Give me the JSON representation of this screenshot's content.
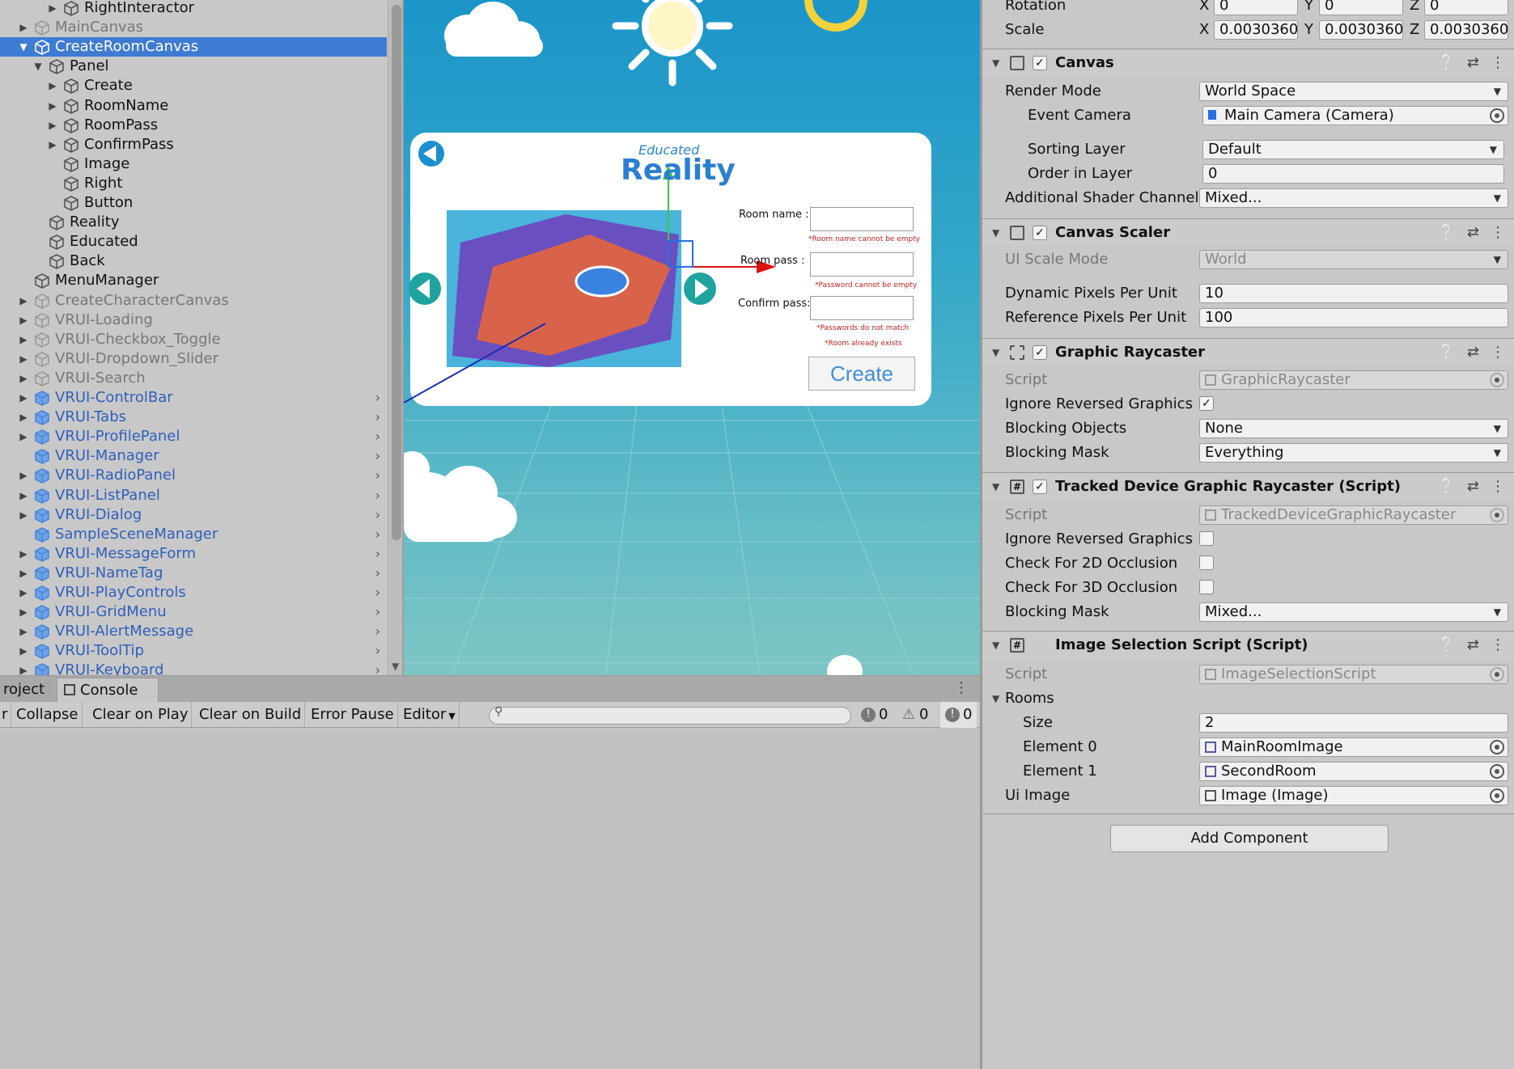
{
  "hierarchy": {
    "items": [
      {
        "label": "RightInteractor",
        "indent": 3,
        "arrow": true,
        "style": "normal"
      },
      {
        "label": "MainCanvas",
        "indent": 1,
        "arrow": true,
        "style": "grey"
      },
      {
        "label": "CreateRoomCanvas",
        "indent": 1,
        "arrow": true,
        "style": "selected",
        "open": true
      },
      {
        "label": "Panel",
        "indent": 2,
        "arrow": true,
        "style": "normal",
        "open": true
      },
      {
        "label": "Create",
        "indent": 3,
        "arrow": true,
        "style": "normal"
      },
      {
        "label": "RoomName",
        "indent": 3,
        "arrow": true,
        "style": "normal"
      },
      {
        "label": "RoomPass",
        "indent": 3,
        "arrow": true,
        "style": "normal"
      },
      {
        "label": "ConfirmPass",
        "indent": 3,
        "arrow": true,
        "style": "normal"
      },
      {
        "label": "Image",
        "indent": 3,
        "arrow": false,
        "style": "normal"
      },
      {
        "label": "Right",
        "indent": 3,
        "arrow": false,
        "style": "normal"
      },
      {
        "label": "Button",
        "indent": 3,
        "arrow": false,
        "style": "normal"
      },
      {
        "label": "Reality",
        "indent": 2,
        "arrow": false,
        "style": "normal"
      },
      {
        "label": "Educated",
        "indent": 2,
        "arrow": false,
        "style": "normal"
      },
      {
        "label": "Back",
        "indent": 2,
        "arrow": false,
        "style": "normal"
      },
      {
        "label": "MenuManager",
        "indent": 1,
        "arrow": false,
        "style": "normal"
      },
      {
        "label": "CreateCharacterCanvas",
        "indent": 1,
        "arrow": true,
        "style": "grey"
      },
      {
        "label": "VRUI-Loading",
        "indent": 1,
        "arrow": true,
        "style": "grey"
      },
      {
        "label": "VRUI-Checkbox_Toggle",
        "indent": 1,
        "arrow": true,
        "style": "grey"
      },
      {
        "label": "VRUI-Dropdown_Slider",
        "indent": 1,
        "arrow": true,
        "style": "grey"
      },
      {
        "label": "VRUI-Search",
        "indent": 1,
        "arrow": true,
        "style": "grey"
      },
      {
        "label": "VRUI-ControlBar",
        "indent": 1,
        "arrow": true,
        "style": "prefab"
      },
      {
        "label": "VRUI-Tabs",
        "indent": 1,
        "arrow": true,
        "style": "prefab"
      },
      {
        "label": "VRUI-ProfilePanel",
        "indent": 1,
        "arrow": true,
        "style": "prefab"
      },
      {
        "label": "VRUI-Manager",
        "indent": 1,
        "arrow": false,
        "style": "prefab"
      },
      {
        "label": "VRUI-RadioPanel",
        "indent": 1,
        "arrow": true,
        "style": "prefab"
      },
      {
        "label": "VRUI-ListPanel",
        "indent": 1,
        "arrow": true,
        "style": "prefab"
      },
      {
        "label": "VRUI-Dialog",
        "indent": 1,
        "arrow": true,
        "style": "prefab"
      },
      {
        "label": "SampleSceneManager",
        "indent": 1,
        "arrow": false,
        "style": "prefab"
      },
      {
        "label": "VRUI-MessageForm",
        "indent": 1,
        "arrow": true,
        "style": "prefab"
      },
      {
        "label": "VRUI-NameTag",
        "indent": 1,
        "arrow": true,
        "style": "prefab"
      },
      {
        "label": "VRUI-PlayControls",
        "indent": 1,
        "arrow": true,
        "style": "prefab"
      },
      {
        "label": "VRUI-GridMenu",
        "indent": 1,
        "arrow": true,
        "style": "prefab"
      },
      {
        "label": "VRUI-AlertMessage",
        "indent": 1,
        "arrow": true,
        "style": "prefab"
      },
      {
        "label": "VRUI-ToolTip",
        "indent": 1,
        "arrow": true,
        "style": "prefab"
      },
      {
        "label": "VRUI-Keyboard",
        "indent": 1,
        "arrow": true,
        "style": "prefab"
      }
    ]
  },
  "scene": {
    "educated": "Educated",
    "reality": "Reality",
    "room_name_label": "Room name :",
    "room_pass_label": "Room pass :",
    "confirm_pass_label": "Confirm pass:",
    "err_room_name": "*Room name cannot be empty",
    "err_password": "*Password cannot be empty",
    "err_match": "*Passwords do not match",
    "err_exists": "*Room already exists",
    "create_button": "Create"
  },
  "console": {
    "tabs": {
      "project": "roject",
      "console": "Console"
    },
    "toolbar": {
      "clear": "r",
      "collapse": "Collapse",
      "clear_on_play": "Clear on Play",
      "clear_on_build": "Clear on Build",
      "error_pause": "Error Pause",
      "editor": "Editor"
    },
    "counts": {
      "info": "0",
      "warnings": "0",
      "errors": "0"
    }
  },
  "inspector": {
    "transform": {
      "rotation_label": "Rotation",
      "rotation": {
        "x": "0",
        "y": "0",
        "z": "0"
      },
      "scale_label": "Scale",
      "scale": {
        "x": "0.0030360",
        "y": "0.0030360",
        "z": "0.0030360"
      },
      "axis": {
        "x": "X",
        "y": "Y",
        "z": "Z"
      }
    },
    "canvas": {
      "title": "Canvas",
      "render_mode_label": "Render Mode",
      "render_mode": "World Space",
      "event_camera_label": "Event Camera",
      "event_camera": "Main Camera (Camera)",
      "sorting_layer_label": "Sorting Layer",
      "sorting_layer": "Default",
      "order_label": "Order in Layer",
      "order": "0",
      "shader_label": "Additional Shader Channel",
      "shader": "Mixed..."
    },
    "canvas_scaler": {
      "title": "Canvas Scaler",
      "ui_scale_label": "UI Scale Mode",
      "ui_scale": "World",
      "dynamic_label": "Dynamic Pixels Per Unit",
      "dynamic": "10",
      "reference_label": "Reference Pixels Per Unit",
      "reference": "100"
    },
    "graphic_raycaster": {
      "title": "Graphic Raycaster",
      "script_label": "Script",
      "script": "GraphicRaycaster",
      "ignore_label": "Ignore Reversed Graphics",
      "ignore_checked": true,
      "blocking_objects_label": "Blocking Objects",
      "blocking_objects": "None",
      "blocking_mask_label": "Blocking Mask",
      "blocking_mask": "Everything"
    },
    "tracked": {
      "title": "Tracked Device Graphic Raycaster (Script)",
      "script_label": "Script",
      "script": "TrackedDeviceGraphicRaycaster",
      "ignore_label": "Ignore Reversed Graphics",
      "occ2d_label": "Check For 2D Occlusion",
      "occ3d_label": "Check For 3D Occlusion",
      "blocking_mask_label": "Blocking Mask",
      "blocking_mask": "Mixed..."
    },
    "image_selection": {
      "title": "Image Selection Script (Script)",
      "script_label": "Script",
      "script": "ImageSelectionScript",
      "rooms_label": "Rooms",
      "size_label": "Size",
      "size": "2",
      "element0_label": "Element 0",
      "element0": "MainRoomImage",
      "element1_label": "Element 1",
      "element1": "SecondRoom",
      "ui_image_label": "Ui Image",
      "ui_image": "Image (Image)"
    },
    "add_component": "Add Component"
  },
  "colors": {
    "selection": "#3e7bd3",
    "prefab_text": "#2f5fba",
    "sky": "#1b95c9"
  }
}
